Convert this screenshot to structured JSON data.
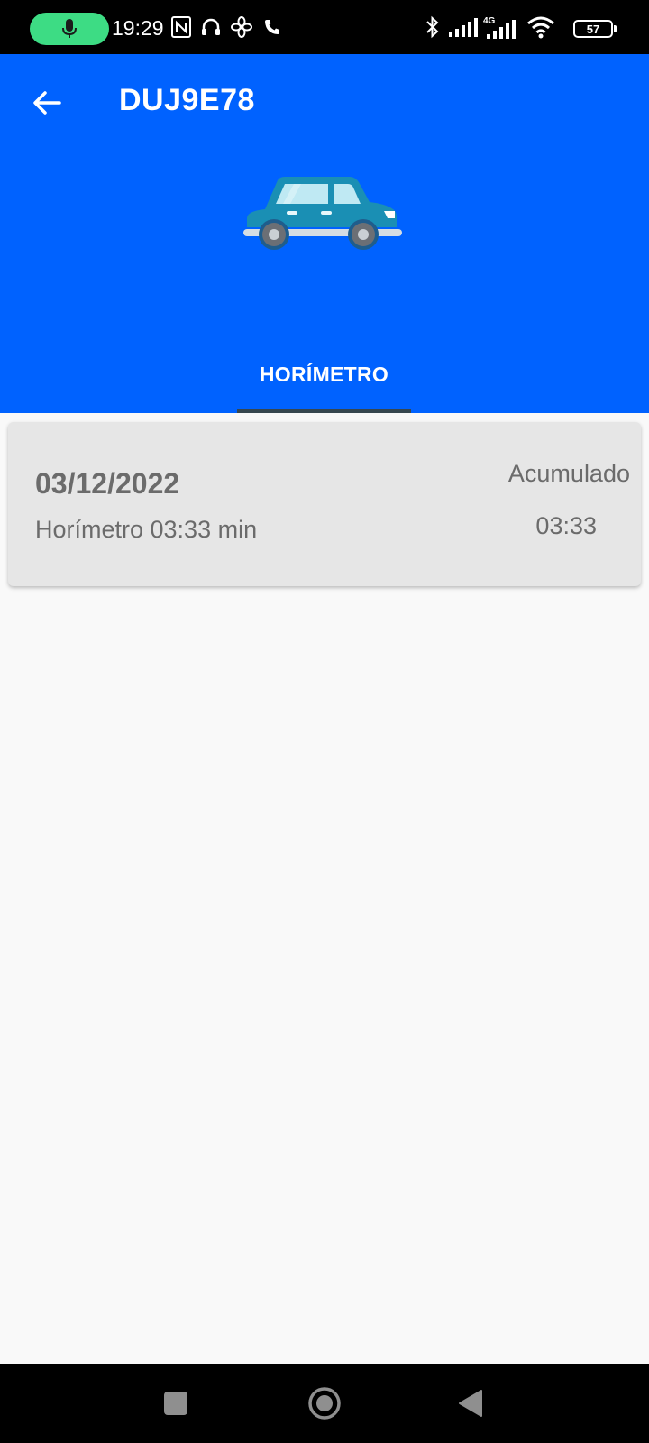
{
  "status_bar": {
    "time": "19:29",
    "battery_level": "57",
    "network_type": "4G"
  },
  "header": {
    "title": "DUJ9E78",
    "background_color": "#0062ff"
  },
  "tabs": [
    {
      "label": "HORÍMETRO",
      "selected": true
    }
  ],
  "records": [
    {
      "date": "03/12/2022",
      "detail": "Horímetro 03:33 min",
      "accumulated_label": "Acumulado",
      "accumulated_value": "03:33"
    }
  ]
}
